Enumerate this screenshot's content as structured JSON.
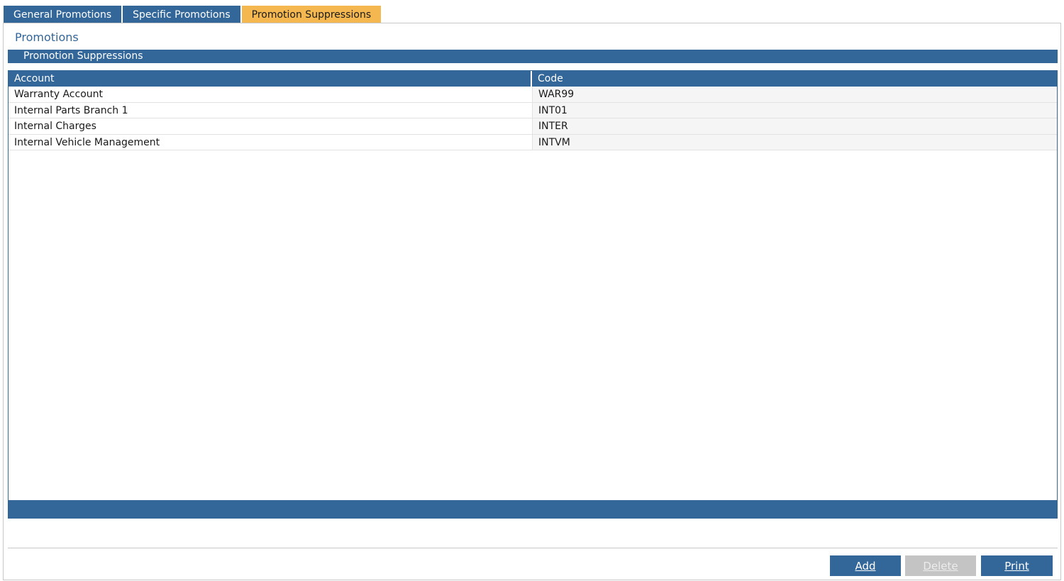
{
  "tabs": [
    {
      "label": "General Promotions",
      "active": false
    },
    {
      "label": "Specific Promotions",
      "active": false
    },
    {
      "label": "Promotion Suppressions",
      "active": true
    }
  ],
  "page_title": "Promotions",
  "section_title": "Promotion Suppressions",
  "table": {
    "columns": [
      "Account",
      "Code"
    ],
    "rows": [
      {
        "account": "Warranty Account",
        "code": "WAR99"
      },
      {
        "account": "Internal Parts Branch 1",
        "code": "INT01"
      },
      {
        "account": "Internal Charges",
        "code": "INTER"
      },
      {
        "account": "Internal Vehicle Management",
        "code": "INTVM"
      }
    ]
  },
  "buttons": {
    "add": "Add",
    "delete": "Delete",
    "print": "Print"
  },
  "colors": {
    "primary": "#336699",
    "active_tab": "#f5b850",
    "disabled": "#c4c4c4"
  }
}
